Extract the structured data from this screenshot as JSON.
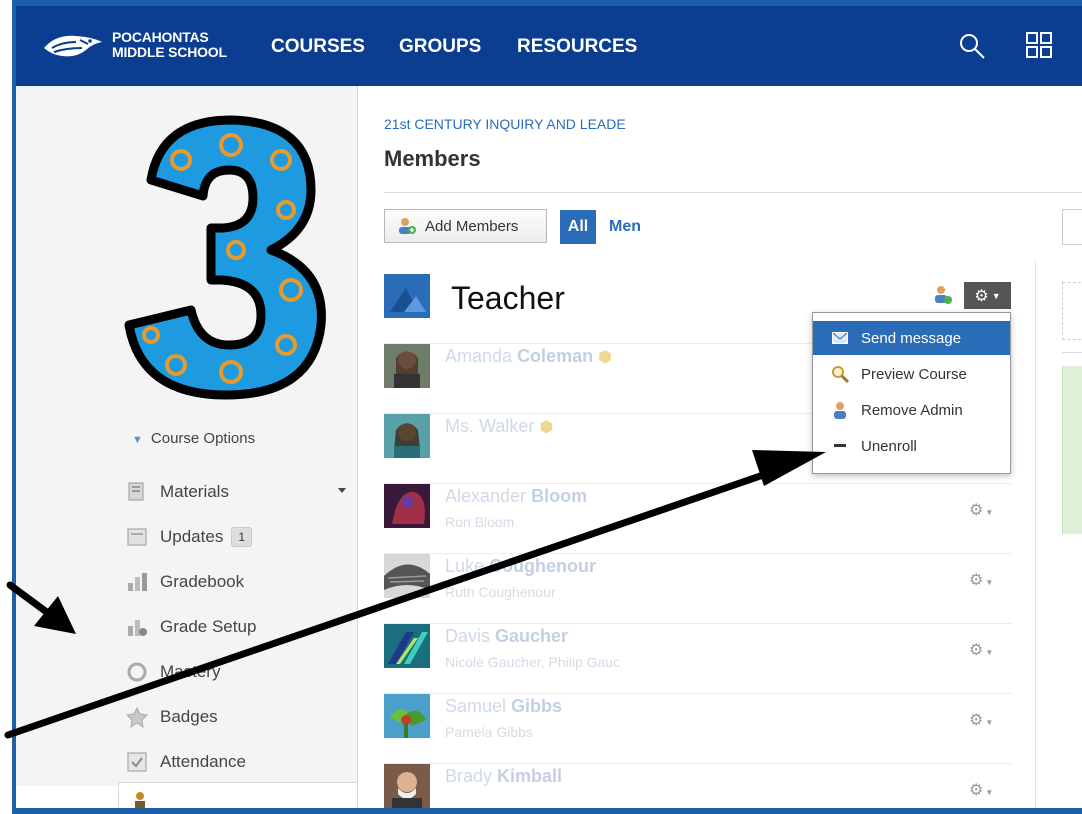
{
  "header": {
    "school_line1": "POCAHONTAS",
    "school_line2": "MIDDLE SCHOOL",
    "nav": [
      "COURSES",
      "GROUPS",
      "RESOURCES"
    ],
    "bg_color": "#0b3d91"
  },
  "sidebar": {
    "course_options": "Course Options",
    "items": [
      {
        "label": "Materials",
        "icon": "materials-icon"
      },
      {
        "label": "Updates",
        "icon": "updates-icon",
        "badge": "1"
      },
      {
        "label": "Gradebook",
        "icon": "gradebook-icon"
      },
      {
        "label": "Grade Setup",
        "icon": "grade-setup-icon"
      },
      {
        "label": "Mastery",
        "icon": "mastery-icon"
      },
      {
        "label": "Badges",
        "icon": "badges-icon"
      },
      {
        "label": "Attendance",
        "icon": "attendance-icon"
      }
    ]
  },
  "main": {
    "breadcrumb": "21st CENTURY INQUIRY AND LEADE",
    "title": "Members",
    "add_members": "Add Members",
    "tab_all": "All",
    "tab_members": "Men",
    "accent_color": "#2a6cb7"
  },
  "members": [
    {
      "first": "Amanda",
      "last": "Coleman",
      "sub": ""
    },
    {
      "first": "Ms. Walker",
      "last": "",
      "sub": ""
    },
    {
      "first": "Alexander",
      "last": "Bloom",
      "sub": "Ron Bloom"
    },
    {
      "first": "Luke",
      "last": "Coughenour",
      "sub": "Ruth Coughenour"
    },
    {
      "first": "Davis",
      "last": "Gaucher",
      "sub": "Nicole Gaucher, Philip Gauc"
    },
    {
      "first": "Samuel",
      "last": "Gibbs",
      "sub": "Pamela Gibbs"
    },
    {
      "first": "Brady",
      "last": "Kimball",
      "sub": ""
    }
  ],
  "annotation": {
    "teacher_label": "Teacher"
  },
  "dropdown": {
    "items": [
      {
        "label": "Send message",
        "icon": "envelope-icon"
      },
      {
        "label": "Preview Course",
        "icon": "magnifier-icon"
      },
      {
        "label": "Remove Admin",
        "icon": "person-icon"
      },
      {
        "label": "Unenroll",
        "icon": "minus-icon"
      }
    ]
  }
}
